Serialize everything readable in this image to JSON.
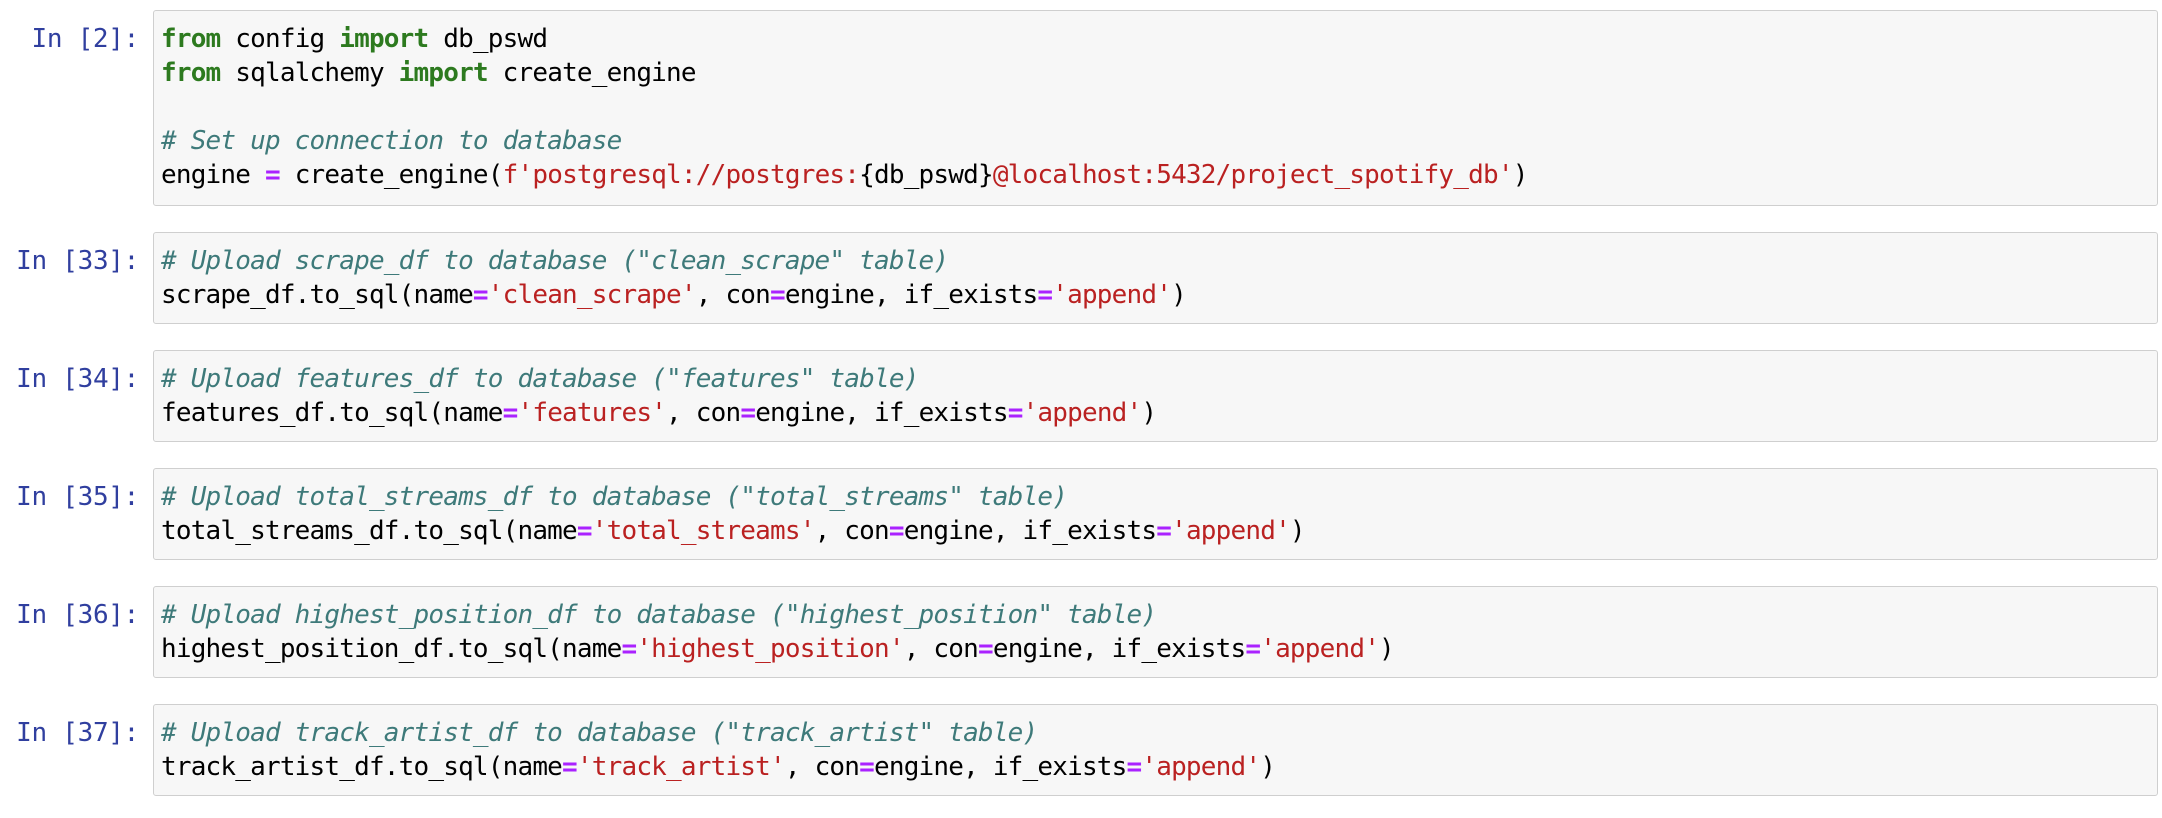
{
  "cells": [
    {
      "prompt": "In [2]:",
      "lines": [
        [
          {
            "t": "kw",
            "v": "from"
          },
          {
            "t": "",
            "v": " config "
          },
          {
            "t": "kw",
            "v": "import"
          },
          {
            "t": "",
            "v": " db_pswd"
          }
        ],
        [
          {
            "t": "kw",
            "v": "from"
          },
          {
            "t": "",
            "v": " sqlalchemy "
          },
          {
            "t": "kw",
            "v": "import"
          },
          {
            "t": "",
            "v": " create_engine"
          }
        ],
        [],
        [
          {
            "t": "cm",
            "v": "# Set up connection to database"
          }
        ],
        [
          {
            "t": "",
            "v": "engine "
          },
          {
            "t": "op",
            "v": "="
          },
          {
            "t": "",
            "v": " create_engine("
          },
          {
            "t": "st",
            "v": "f'postgresql://postgres:"
          },
          {
            "t": "",
            "v": "{db_pswd}"
          },
          {
            "t": "st",
            "v": "@localhost:5432/project_spotify_db'"
          },
          {
            "t": "",
            "v": ")"
          }
        ]
      ]
    },
    {
      "prompt": "In [33]:",
      "lines": [
        [
          {
            "t": "cm",
            "v": "# Upload scrape_df to database (\"clean_scrape\" table)"
          }
        ],
        [
          {
            "t": "",
            "v": "scrape_df.to_sql(name"
          },
          {
            "t": "op",
            "v": "="
          },
          {
            "t": "st",
            "v": "'clean_scrape'"
          },
          {
            "t": "",
            "v": ", con"
          },
          {
            "t": "op",
            "v": "="
          },
          {
            "t": "",
            "v": "engine, if_exists"
          },
          {
            "t": "op",
            "v": "="
          },
          {
            "t": "st",
            "v": "'append'"
          },
          {
            "t": "",
            "v": ")"
          }
        ]
      ]
    },
    {
      "prompt": "In [34]:",
      "lines": [
        [
          {
            "t": "cm",
            "v": "# Upload features_df to database (\"features\" table)"
          }
        ],
        [
          {
            "t": "",
            "v": "features_df.to_sql(name"
          },
          {
            "t": "op",
            "v": "="
          },
          {
            "t": "st",
            "v": "'features'"
          },
          {
            "t": "",
            "v": ", con"
          },
          {
            "t": "op",
            "v": "="
          },
          {
            "t": "",
            "v": "engine, if_exists"
          },
          {
            "t": "op",
            "v": "="
          },
          {
            "t": "st",
            "v": "'append'"
          },
          {
            "t": "",
            "v": ")"
          }
        ]
      ]
    },
    {
      "prompt": "In [35]:",
      "lines": [
        [
          {
            "t": "cm",
            "v": "# Upload total_streams_df to database (\"total_streams\" table)"
          }
        ],
        [
          {
            "t": "",
            "v": "total_streams_df.to_sql(name"
          },
          {
            "t": "op",
            "v": "="
          },
          {
            "t": "st",
            "v": "'total_streams'"
          },
          {
            "t": "",
            "v": ", con"
          },
          {
            "t": "op",
            "v": "="
          },
          {
            "t": "",
            "v": "engine, if_exists"
          },
          {
            "t": "op",
            "v": "="
          },
          {
            "t": "st",
            "v": "'append'"
          },
          {
            "t": "",
            "v": ")"
          }
        ]
      ]
    },
    {
      "prompt": "In [36]:",
      "lines": [
        [
          {
            "t": "cm",
            "v": "# Upload highest_position_df to database (\"highest_position\" table)"
          }
        ],
        [
          {
            "t": "",
            "v": "highest_position_df.to_sql(name"
          },
          {
            "t": "op",
            "v": "="
          },
          {
            "t": "st",
            "v": "'highest_position'"
          },
          {
            "t": "",
            "v": ", con"
          },
          {
            "t": "op",
            "v": "="
          },
          {
            "t": "",
            "v": "engine, if_exists"
          },
          {
            "t": "op",
            "v": "="
          },
          {
            "t": "st",
            "v": "'append'"
          },
          {
            "t": "",
            "v": ")"
          }
        ]
      ]
    },
    {
      "prompt": "In [37]:",
      "lines": [
        [
          {
            "t": "cm",
            "v": "# Upload track_artist_df to database (\"track_artist\" table)"
          }
        ],
        [
          {
            "t": "",
            "v": "track_artist_df.to_sql(name"
          },
          {
            "t": "op",
            "v": "="
          },
          {
            "t": "st",
            "v": "'track_artist'"
          },
          {
            "t": "",
            "v": ", con"
          },
          {
            "t": "op",
            "v": "="
          },
          {
            "t": "",
            "v": "engine, if_exists"
          },
          {
            "t": "op",
            "v": "="
          },
          {
            "t": "st",
            "v": "'append'"
          },
          {
            "t": "",
            "v": ")"
          }
        ]
      ]
    }
  ]
}
